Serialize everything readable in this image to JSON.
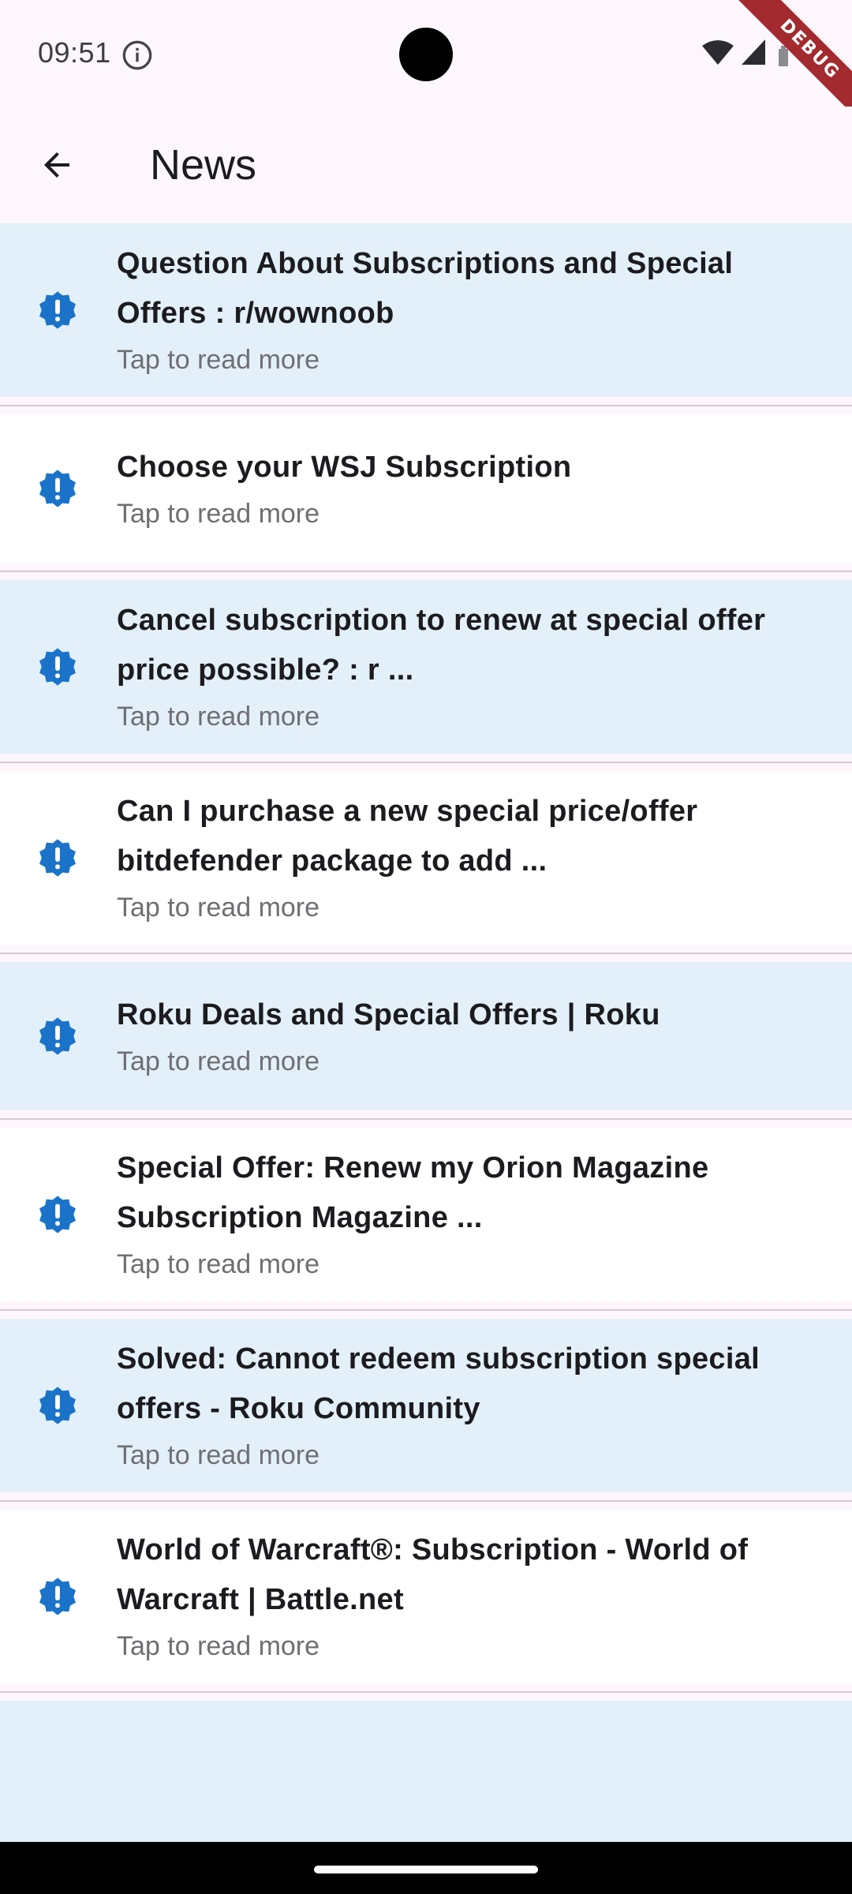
{
  "status_bar": {
    "time": "09:51",
    "debug_label": "DEBUG"
  },
  "app_bar": {
    "title": "News"
  },
  "colors": {
    "accent": "#1a73c9",
    "highlight_row": "#e3f0fa",
    "debug_ribbon": "#a32a2f"
  },
  "news": {
    "items": [
      {
        "title": "Question About Subscriptions and Special Offers : r/wownoob",
        "subtitle": "Tap to read more",
        "icon": "alert-badge-icon"
      },
      {
        "title": "Choose your WSJ Subscription",
        "subtitle": "Tap to read more",
        "icon": "alert-badge-icon"
      },
      {
        "title": "Cancel subscription to renew at special offer price possible? : r ...",
        "subtitle": "Tap to read more",
        "icon": "alert-badge-icon"
      },
      {
        "title": "Can I purchase a new special price/offer bitdefender package to add ...",
        "subtitle": "Tap to read more",
        "icon": "alert-badge-icon"
      },
      {
        "title": "Roku Deals and Special Offers | Roku",
        "subtitle": "Tap to read more",
        "icon": "alert-badge-icon"
      },
      {
        "title": "Special Offer: Renew my Orion Magazine Subscription Magazine ...",
        "subtitle": "Tap to read more",
        "icon": "alert-badge-icon"
      },
      {
        "title": "Solved: Cannot redeem subscription special offers - Roku Community",
        "subtitle": "Tap to read more",
        "icon": "alert-badge-icon"
      },
      {
        "title": "World of Warcraft®: Subscription - World of Warcraft | Battle.net",
        "subtitle": "Tap to read more",
        "icon": "alert-badge-icon"
      }
    ]
  }
}
